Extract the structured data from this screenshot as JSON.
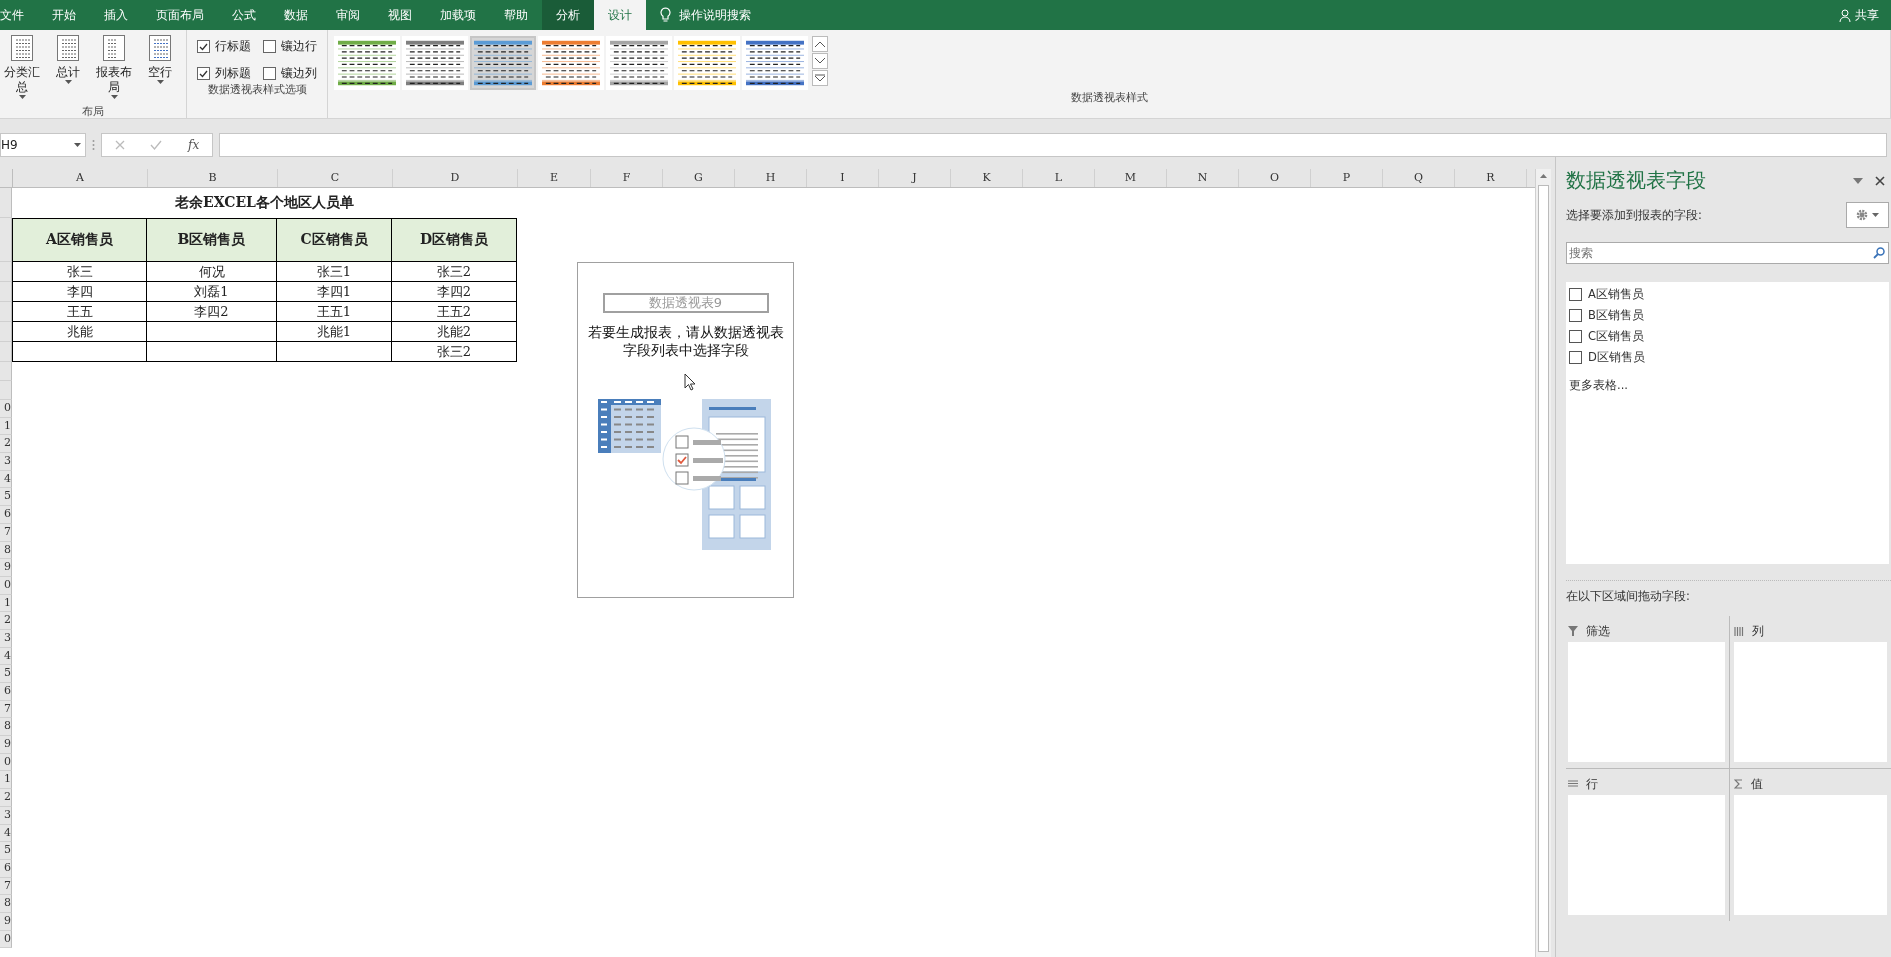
{
  "ribbon_tabs": [
    {
      "label": "文件",
      "selected": false,
      "contextual": false
    },
    {
      "label": "开始",
      "selected": false,
      "contextual": false
    },
    {
      "label": "插入",
      "selected": false,
      "contextual": false
    },
    {
      "label": "页面布局",
      "selected": false,
      "contextual": false
    },
    {
      "label": "公式",
      "selected": false,
      "contextual": false
    },
    {
      "label": "数据",
      "selected": false,
      "contextual": false
    },
    {
      "label": "审阅",
      "selected": false,
      "contextual": false
    },
    {
      "label": "视图",
      "selected": false,
      "contextual": false
    },
    {
      "label": "加载项",
      "selected": false,
      "contextual": false
    },
    {
      "label": "帮助",
      "selected": false,
      "contextual": false
    },
    {
      "label": "分析",
      "selected": false,
      "contextual": true
    },
    {
      "label": "设计",
      "selected": true,
      "contextual": true
    }
  ],
  "tell_me": "操作说明搜索",
  "share": "共享",
  "ribbon_groups": [
    {
      "kind": "buttons",
      "label": "布局",
      "buttons": [
        {
          "label": "分类汇总",
          "dropdown": true
        },
        {
          "label": "总计",
          "dropdown": true
        },
        {
          "label": "报表布局",
          "dropdown": true
        },
        {
          "label": "空行",
          "dropdown": true
        }
      ]
    },
    {
      "kind": "checkboxes",
      "label": "数据透视表样式选项",
      "options": [
        {
          "label": "行标题",
          "checked": true
        },
        {
          "label": "镶边行",
          "checked": false
        },
        {
          "label": "列标题",
          "checked": true
        },
        {
          "label": "镶边列",
          "checked": false
        }
      ]
    },
    {
      "kind": "gallery",
      "label": "数据透视表样式",
      "styles": [
        {
          "color": "#70ad47",
          "selected": false
        },
        {
          "color": "#7f7f7f",
          "selected": false
        },
        {
          "color": "#5b9bd5",
          "selected": true
        },
        {
          "color": "#ed7d31",
          "selected": false
        },
        {
          "color": "#a5a5a5",
          "selected": false
        },
        {
          "color": "#ffc000",
          "selected": false
        },
        {
          "color": "#4472c4",
          "selected": false
        }
      ]
    }
  ],
  "name_box": "H9",
  "function_label": "fx",
  "columns": [
    "A",
    "B",
    "C",
    "D",
    "E",
    "F",
    "G",
    "H",
    "I",
    "J",
    "K",
    "L",
    "M",
    "N",
    "O",
    "P",
    "Q",
    "R"
  ],
  "row_numbers": [
    "0",
    "1",
    "2",
    "3",
    "4",
    "5",
    "6",
    "7",
    "8",
    "9",
    "0",
    "1",
    "2",
    "3",
    "4",
    "5",
    "6",
    "7",
    "8",
    "9",
    "0",
    "1",
    "2",
    "3",
    "4",
    "5",
    "6",
    "7",
    "8",
    "9",
    "0"
  ],
  "sheet_table": {
    "title": "老余EXCEL各个地区人员单",
    "headers": [
      "A区销售员",
      "B区销售员",
      "C区销售员",
      "D区销售员"
    ],
    "rows": [
      [
        "张三",
        "何况",
        "张三1",
        "张三2"
      ],
      [
        "李四",
        "刘磊1",
        "李四1",
        "李四2"
      ],
      [
        "王五",
        "李四2",
        "王五1",
        "王五2"
      ],
      [
        "兆能",
        null,
        "兆能1",
        "兆能2"
      ],
      [
        null,
        null,
        null,
        "张三2"
      ]
    ]
  },
  "pivot_placeholder": {
    "name": "数据透视表9",
    "message": "若要生成报表，请从数据透视表字段列表中选择字段"
  },
  "field_pane": {
    "title": "数据透视表字段",
    "subtitle": "选择要添加到报表的字段:",
    "search_placeholder": "搜索",
    "fields": [
      {
        "label": "A区销售员",
        "checked": false
      },
      {
        "label": "B区销售员",
        "checked": false
      },
      {
        "label": "C区销售员",
        "checked": false
      },
      {
        "label": "D区销售员",
        "checked": false
      }
    ],
    "more_tables": "更多表格...",
    "areas_label": "在以下区域间拖动字段:",
    "areas": [
      {
        "kind": "filter",
        "label": "筛选"
      },
      {
        "kind": "columns",
        "label": "列"
      },
      {
        "kind": "rows",
        "label": "行"
      },
      {
        "kind": "values",
        "label": "值"
      }
    ]
  }
}
